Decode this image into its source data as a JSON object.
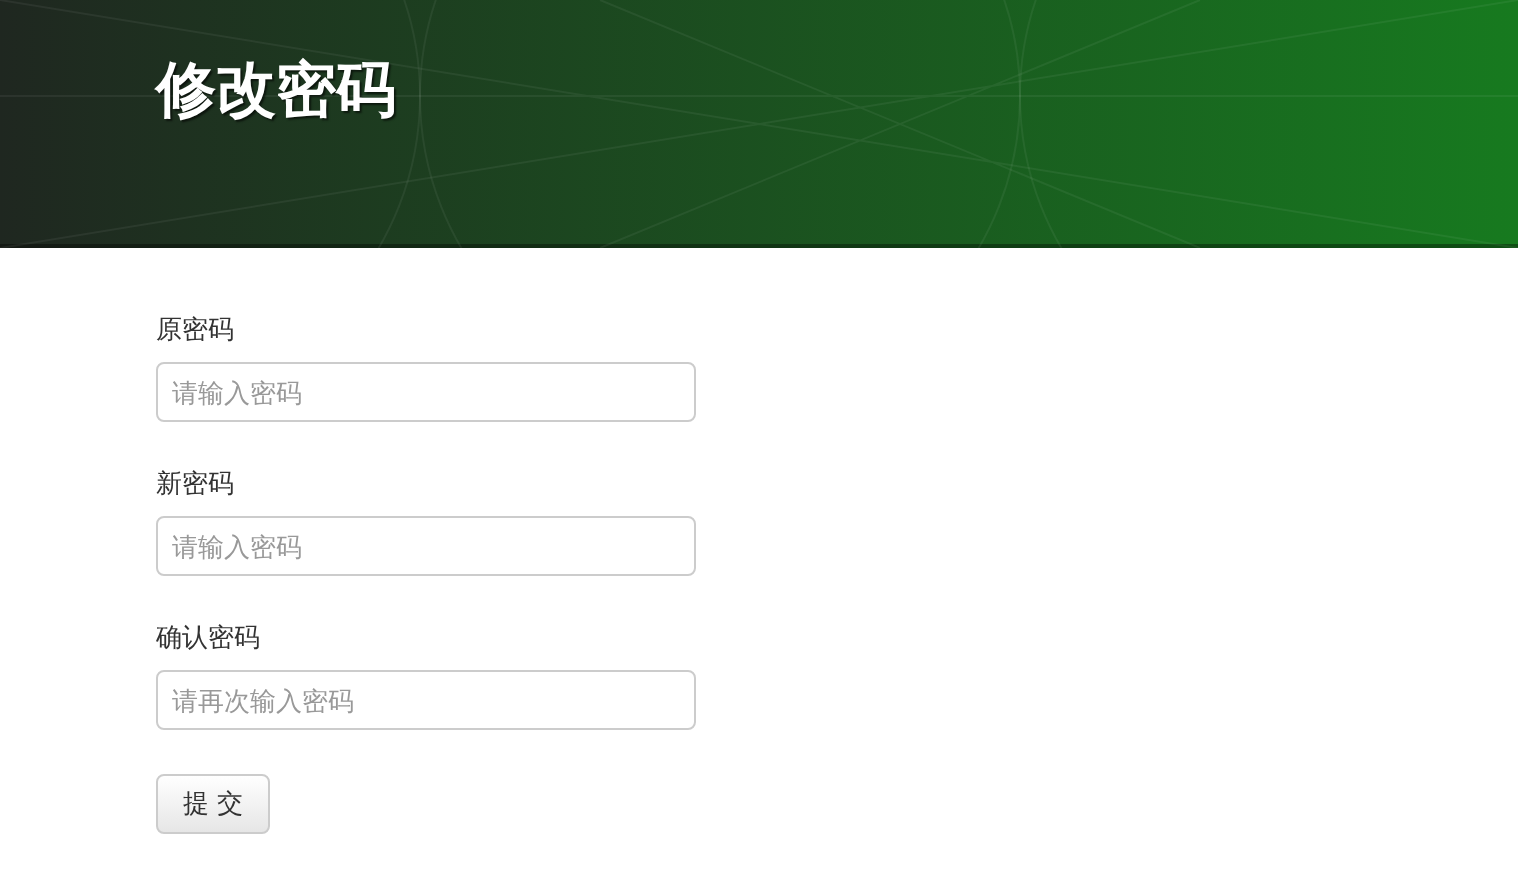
{
  "header": {
    "title": "修改密码"
  },
  "form": {
    "fields": [
      {
        "label": "原密码",
        "placeholder": "请输入密码"
      },
      {
        "label": "新密码",
        "placeholder": "请输入密码"
      },
      {
        "label": "确认密码",
        "placeholder": "请再次输入密码"
      }
    ],
    "submit": "提 交"
  }
}
